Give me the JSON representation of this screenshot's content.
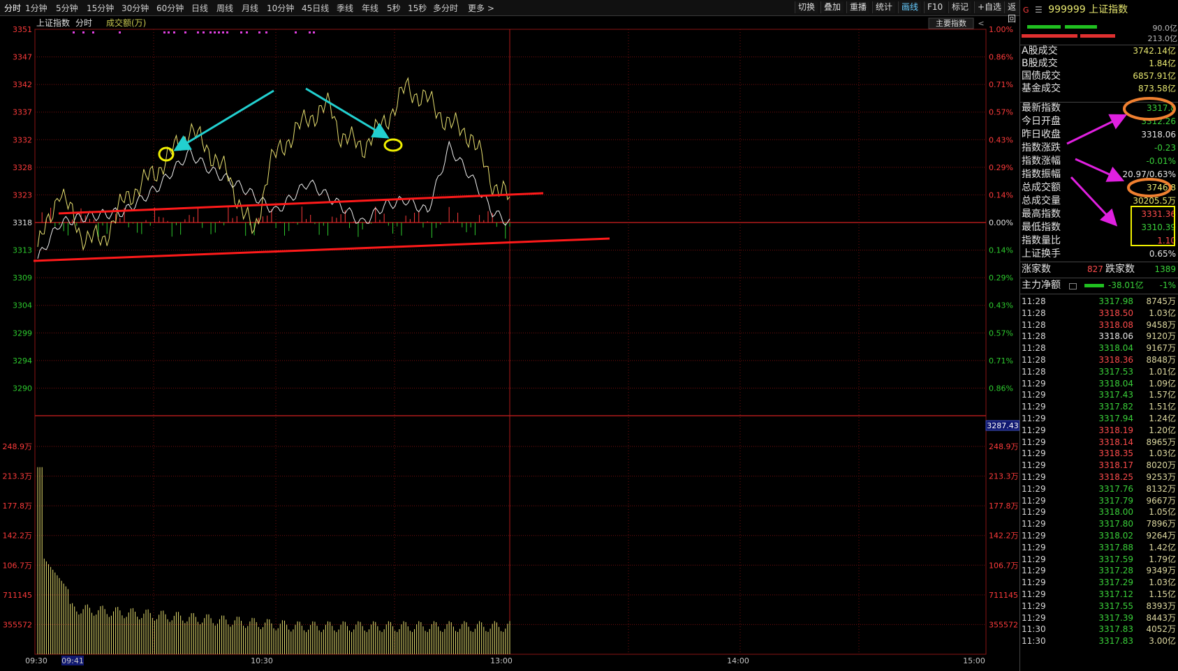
{
  "toolbar": {
    "periods": [
      "分时",
      "1分钟",
      "5分钟",
      "15分钟",
      "30分钟",
      "60分钟",
      "日线",
      "周线",
      "月线",
      "10分钟",
      "45日线",
      "季线",
      "年线",
      "5秒",
      "15秒",
      "多分时",
      "更多 >"
    ],
    "right": [
      "切换",
      "叠加",
      "重播",
      "统计",
      "画线",
      "F10",
      "标记",
      "+自选",
      "返回"
    ]
  },
  "chart": {
    "header": [
      "上证指数",
      "分时",
      "成交额(万)"
    ],
    "main_indicator_btn": "主要指数",
    "price_labels": [
      "3351",
      "3347",
      "3342",
      "3337",
      "3332",
      "3328",
      "3323",
      "3318",
      "3313",
      "3309",
      "3304",
      "3299",
      "3294",
      "3290"
    ],
    "pct_labels": [
      "1.00%",
      "0.86%",
      "0.71%",
      "0.57%",
      "0.43%",
      "0.29%",
      "0.14%",
      "0.00%",
      "0.14%",
      "0.29%",
      "0.43%",
      "0.57%",
      "0.71%",
      "0.86%"
    ],
    "current_price_tag": "3287.43",
    "vol_labels": [
      "248.9万",
      "213.3万",
      "177.8万",
      "142.2万",
      "106.7万",
      "711145",
      "355572"
    ],
    "time_labels": [
      "09:30",
      "09:41",
      "10:30",
      "13:00",
      "14:00",
      "15:00"
    ],
    "colors": {
      "up": "#ff3b3b",
      "down": "#2ecc2e",
      "grid": "#7a0f0f",
      "price_line": "#e8e8e8",
      "avg_line": "#e8e070",
      "trend": "#ff1a1a",
      "arrow_cyan": "#22d0d0",
      "arrow_magenta": "#e020e0",
      "circle_yellow": "#f0f000",
      "circle_orange": "#f08030"
    }
  },
  "panel": {
    "code": "999999",
    "name": "上证指数",
    "bar_vals": [
      "90.0亿",
      "213.0亿"
    ],
    "rows1": [
      {
        "label": "A股成交",
        "value": "3742.14亿",
        "cls": "ye"
      },
      {
        "label": "B股成交",
        "value": "1.84亿",
        "cls": "ye"
      },
      {
        "label": "国债成交",
        "value": "6857.91亿",
        "cls": "ye"
      },
      {
        "label": "基金成交",
        "value": "873.58亿",
        "cls": "ye"
      }
    ],
    "rows2": [
      {
        "label": "最新指数",
        "value": "3317.8",
        "cls": "dn"
      },
      {
        "label": "今日开盘",
        "value": "3312.26",
        "cls": "dn"
      },
      {
        "label": "昨日收盘",
        "value": "3318.06",
        "cls": "fl"
      },
      {
        "label": "指数涨跌",
        "value": "-0.23",
        "cls": "dn"
      },
      {
        "label": "指数涨幅",
        "value": "-0.01%",
        "cls": "dn"
      },
      {
        "label": "指数振幅",
        "value": "20.97/0.63%",
        "cls": "fl"
      },
      {
        "label": "总成交额",
        "value": "3746.8",
        "cls": "ye"
      },
      {
        "label": "总成交量",
        "value": "30205.5万",
        "cls": "ye"
      },
      {
        "label": "最高指数",
        "value": "3331.36",
        "cls": "up"
      },
      {
        "label": "最低指数",
        "value": "3310.39",
        "cls": "dn"
      },
      {
        "label": "指数量比",
        "value": "1.10",
        "cls": "up"
      },
      {
        "label": "上证换手",
        "value": "0.65%",
        "cls": "fl"
      }
    ],
    "updown": {
      "up_label": "涨家数",
      "up_val": "827",
      "down_label": "跌家数",
      "down_val": "1389"
    },
    "capital": {
      "label": "主力净额",
      "value": "-38.01亿",
      "pct": "-1%"
    },
    "ticks": [
      [
        "11:28",
        "3317.98",
        "8745万",
        "dn"
      ],
      [
        "11:28",
        "3318.50",
        "1.03亿",
        "up"
      ],
      [
        "11:28",
        "3318.08",
        "9458万",
        "up"
      ],
      [
        "11:28",
        "3318.06",
        "9120万",
        "fl"
      ],
      [
        "11:28",
        "3318.04",
        "9167万",
        "dn"
      ],
      [
        "11:28",
        "3318.36",
        "8848万",
        "up"
      ],
      [
        "11:28",
        "3317.53",
        "1.01亿",
        "dn"
      ],
      [
        "11:29",
        "3318.04",
        "1.09亿",
        "dn"
      ],
      [
        "11:29",
        "3317.43",
        "1.57亿",
        "dn"
      ],
      [
        "11:29",
        "3317.82",
        "1.51亿",
        "dn"
      ],
      [
        "11:29",
        "3317.94",
        "1.24亿",
        "dn"
      ],
      [
        "11:29",
        "3318.19",
        "1.20亿",
        "up"
      ],
      [
        "11:29",
        "3318.14",
        "8965万",
        "up"
      ],
      [
        "11:29",
        "3318.35",
        "1.03亿",
        "up"
      ],
      [
        "11:29",
        "3318.17",
        "8020万",
        "up"
      ],
      [
        "11:29",
        "3318.25",
        "9253万",
        "up"
      ],
      [
        "11:29",
        "3317.76",
        "8132万",
        "dn"
      ],
      [
        "11:29",
        "3317.79",
        "9667万",
        "dn"
      ],
      [
        "11:29",
        "3318.00",
        "1.05亿",
        "dn"
      ],
      [
        "11:29",
        "3317.80",
        "7896万",
        "dn"
      ],
      [
        "11:29",
        "3318.02",
        "9264万",
        "dn"
      ],
      [
        "11:29",
        "3317.88",
        "1.42亿",
        "dn"
      ],
      [
        "11:29",
        "3317.59",
        "1.79亿",
        "dn"
      ],
      [
        "11:29",
        "3317.28",
        "9349万",
        "dn"
      ],
      [
        "11:29",
        "3317.29",
        "1.03亿",
        "dn"
      ],
      [
        "11:29",
        "3317.12",
        "1.15亿",
        "dn"
      ],
      [
        "11:29",
        "3317.55",
        "8393万",
        "dn"
      ],
      [
        "11:29",
        "3317.39",
        "8443万",
        "dn"
      ],
      [
        "11:30",
        "3317.83",
        "4052万",
        "dn"
      ],
      [
        "11:30",
        "3317.83",
        "3.00亿",
        "dn"
      ]
    ]
  }
}
